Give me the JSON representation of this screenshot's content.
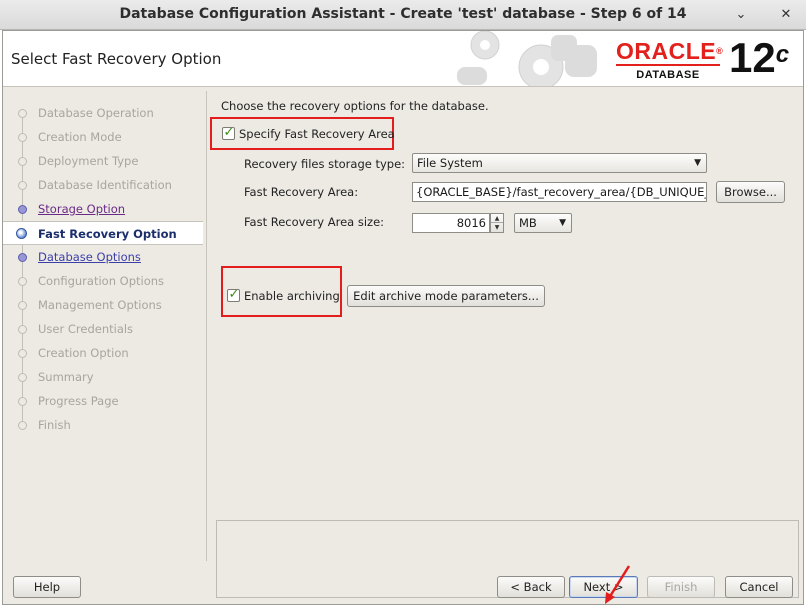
{
  "window": {
    "title": "Database Configuration Assistant - Create 'test' database - Step 6 of 14",
    "minimize_glyph": "⌄",
    "close_glyph": "✕"
  },
  "header": {
    "page_title": "Select Fast Recovery Option",
    "oracle_word": "ORACLE",
    "oracle_registered": "®",
    "oracle_sub": "DATABASE",
    "version": "12",
    "version_suffix": "c"
  },
  "steps": [
    {
      "label": "Database Operation",
      "state": "disabled"
    },
    {
      "label": "Creation Mode",
      "state": "disabled"
    },
    {
      "label": "Deployment Type",
      "state": "disabled"
    },
    {
      "label": "Database Identification",
      "state": "disabled"
    },
    {
      "label": "Storage Option",
      "state": "visited"
    },
    {
      "label": "Fast Recovery Option",
      "state": "current"
    },
    {
      "label": "Database Options",
      "state": "link"
    },
    {
      "label": "Configuration Options",
      "state": "disabled"
    },
    {
      "label": "Management Options",
      "state": "disabled"
    },
    {
      "label": "User Credentials",
      "state": "disabled"
    },
    {
      "label": "Creation Option",
      "state": "disabled"
    },
    {
      "label": "Summary",
      "state": "disabled"
    },
    {
      "label": "Progress Page",
      "state": "disabled"
    },
    {
      "label": "Finish",
      "state": "disabled"
    }
  ],
  "content": {
    "intro": "Choose the recovery options for the database.",
    "specify_fra": {
      "label": "Specify Fast Recovery Area",
      "checked": true
    },
    "storage_type": {
      "label": "Recovery files storage type:",
      "value": "File System"
    },
    "fra_location": {
      "label": "Fast Recovery Area:",
      "value": "{ORACLE_BASE}/fast_recovery_area/{DB_UNIQUE_",
      "browse_label": "Browse..."
    },
    "fra_size": {
      "label": "Fast Recovery Area size:",
      "value": "8016",
      "unit": "MB"
    },
    "archiving": {
      "label": "Enable archiving",
      "checked": true,
      "edit_params_label": "Edit archive mode parameters..."
    }
  },
  "buttons": {
    "help": "Help",
    "back": "< Back",
    "next": "Next >",
    "finish": "Finish",
    "cancel": "Cancel"
  },
  "colors": {
    "highlight_box": "#e31c1c",
    "oracle_red": "#e2201c",
    "check": "#3b8b16"
  }
}
